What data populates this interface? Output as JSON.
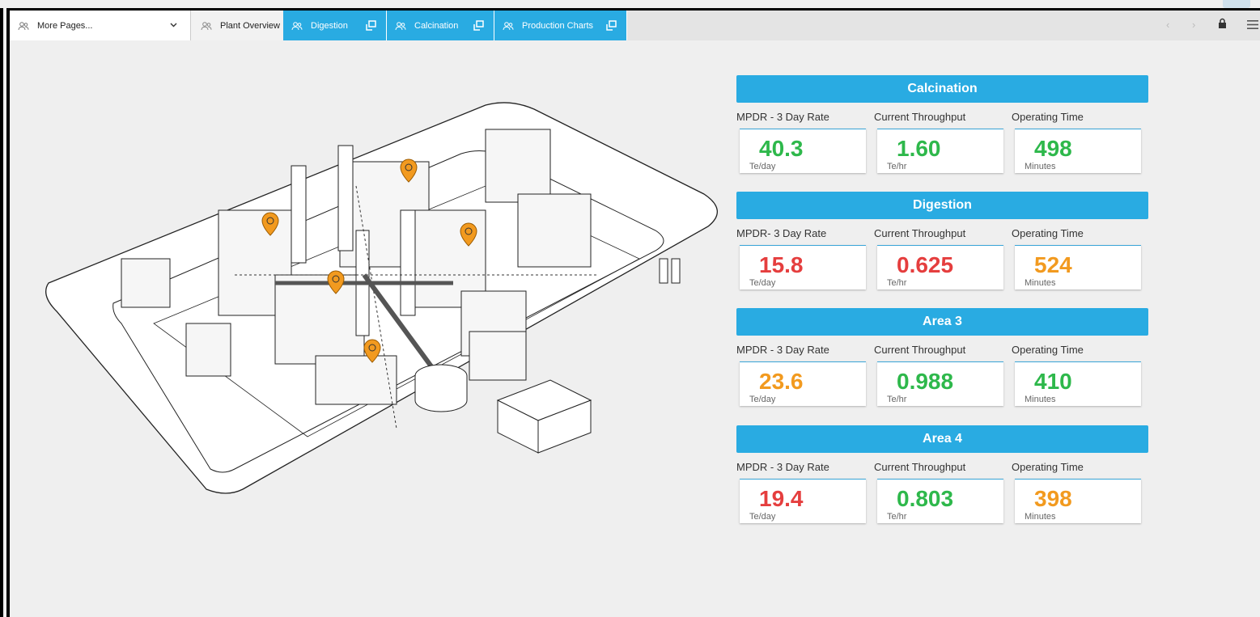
{
  "tabs": {
    "more": "More Pages...",
    "plant": "Plant Overview",
    "digestion": "Digestion",
    "calcination": "Calcination",
    "production": "Production Charts"
  },
  "nav": {
    "prev": "‹",
    "next": "›"
  },
  "colors": {
    "accent": "#29abe2",
    "good": "#2eb84b",
    "bad": "#e53e3e",
    "warn": "#f29a1f",
    "marker": "#f29a1f"
  },
  "panels": [
    {
      "title": "Calcination",
      "labels": [
        "MPDR - 3 Day Rate",
        "Current Throughput",
        "Operating Time"
      ],
      "values": [
        "40.3",
        "1.60",
        "498"
      ],
      "units": [
        "Te/day",
        "Te/hr",
        "Minutes"
      ],
      "status": [
        "green",
        "green",
        "green"
      ]
    },
    {
      "title": "Digestion",
      "labels": [
        "MPDR- 3 Day Rate",
        "Current Throughput",
        "Operating Time"
      ],
      "values": [
        "15.8",
        "0.625",
        "524"
      ],
      "units": [
        "Te/day",
        "Te/hr",
        "Minutes"
      ],
      "status": [
        "red",
        "red",
        "orange"
      ]
    },
    {
      "title": "Area 3",
      "labels": [
        "MPDR - 3 Day Rate",
        "Current Throughput",
        "Operating Time"
      ],
      "values": [
        "23.6",
        "0.988",
        "410"
      ],
      "units": [
        "Te/day",
        "Te/hr",
        "Minutes"
      ],
      "status": [
        "orange",
        "green",
        "green"
      ]
    },
    {
      "title": "Area 4",
      "labels": [
        "MPDR - 3 Day Rate",
        "Current Throughput",
        "Operating Time"
      ],
      "values": [
        "19.4",
        "0.803",
        "398"
      ],
      "units": [
        "Te/day",
        "Te/hr",
        "Minutes"
      ],
      "status": [
        "red",
        "green",
        "orange"
      ]
    }
  ]
}
